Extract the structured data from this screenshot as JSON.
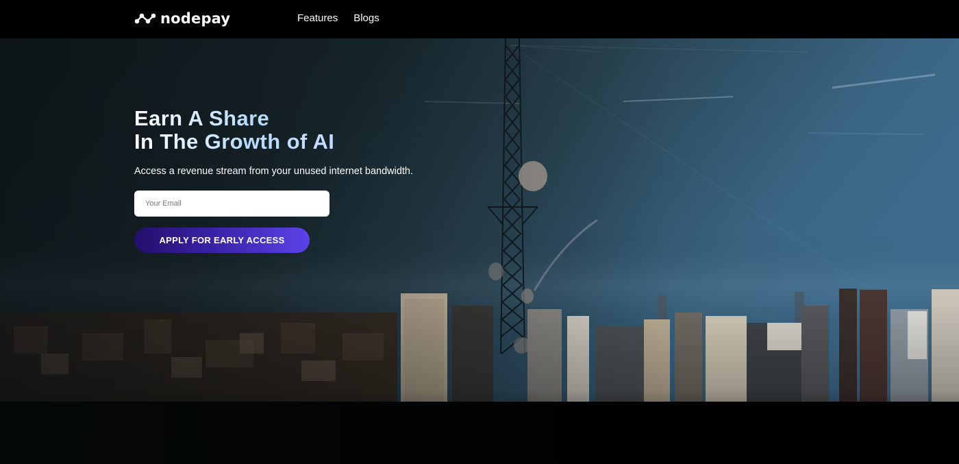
{
  "brand": {
    "name": "nodepay",
    "logo_icon": "nodes-wave-icon"
  },
  "nav": {
    "items": [
      {
        "label": "Features"
      },
      {
        "label": "Blogs"
      }
    ]
  },
  "hero": {
    "headline_line1": "Earn A Share",
    "headline_line2": "In The Growth of AI",
    "subtitle": "Access a revenue stream from your unused internet bandwidth.",
    "email_placeholder": "Your Email",
    "email_value": "",
    "cta_label": "APPLY FOR EARLY ACCESS",
    "background": "city-skyline-with-radio-tower"
  },
  "colors": {
    "topbar_bg": "#000000",
    "cta_gradient_start": "#23106a",
    "cta_gradient_end": "#5a43e8",
    "headline_accent": "#b7dcff"
  }
}
